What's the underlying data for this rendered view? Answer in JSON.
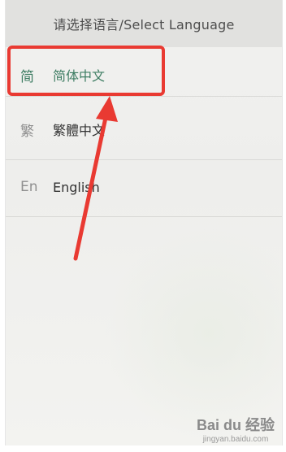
{
  "header": {
    "title": "请选择语言/Select Language"
  },
  "languages": [
    {
      "glyph": "简",
      "label": "简体中文",
      "selected": true
    },
    {
      "glyph": "繁",
      "label": "繁體中文",
      "selected": false
    },
    {
      "glyph": "En",
      "label": "English",
      "selected": false
    }
  ],
  "colors": {
    "highlight": "#e93a32",
    "arrow": "#e93a32",
    "selected_text": "#3e7d63"
  },
  "watermark": {
    "logo": "Bai du 经验",
    "url": "jingyan.baidu.com"
  }
}
